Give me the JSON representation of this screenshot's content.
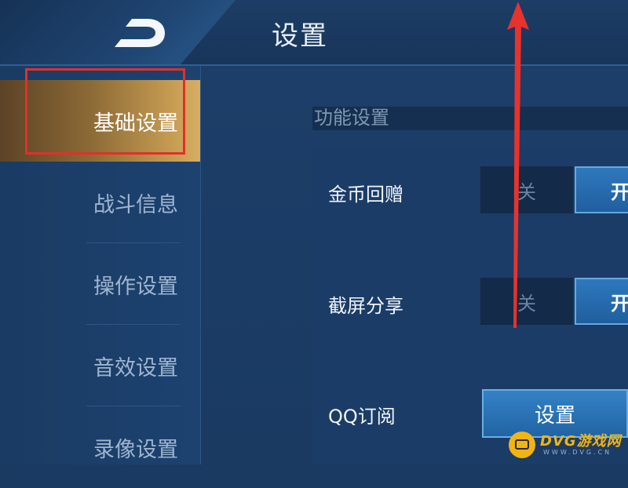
{
  "header": {
    "title": "设置"
  },
  "sidebar": {
    "items": [
      {
        "label": "基础设置",
        "active": true
      },
      {
        "label": "战斗信息",
        "active": false
      },
      {
        "label": "操作设置",
        "active": false
      },
      {
        "label": "音效设置",
        "active": false
      },
      {
        "label": "录像设置",
        "active": false
      }
    ]
  },
  "main": {
    "section_title": "功能设置",
    "rows": [
      {
        "label": "金币回赠",
        "off_label": "关",
        "on_label": "开",
        "state": "on"
      },
      {
        "label": "截屏分享",
        "off_label": "关",
        "on_label": "开",
        "state": "on"
      }
    ],
    "qq": {
      "label": "QQ订阅",
      "button_label": "设置"
    }
  },
  "watermark": {
    "brand": "DVG游戏网",
    "url": "WWW.DVG.CN"
  },
  "colors": {
    "active_tab": "#c59b52",
    "toggle_on": "#2f78bd",
    "annotation": "#e0302b",
    "brand": "#f2b413"
  }
}
